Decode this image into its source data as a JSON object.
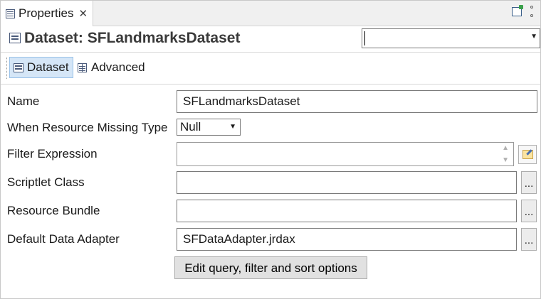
{
  "tab": {
    "label": "Properties",
    "close_glyph": "✕"
  },
  "header": {
    "title": "Dataset: SFLandmarksDataset",
    "dropdown_value": ""
  },
  "subtabs": [
    {
      "label": "Dataset",
      "icon": "dataset-icon",
      "active": true
    },
    {
      "label": "Advanced",
      "icon": "grid-icon",
      "active": false
    }
  ],
  "form": {
    "name": {
      "label": "Name",
      "value": "SFLandmarksDataset"
    },
    "resource_missing": {
      "label": "When Resource Missing Type",
      "value": "Null"
    },
    "filter_expression": {
      "label": "Filter Expression",
      "value": ""
    },
    "scriptlet_class": {
      "label": "Scriptlet Class",
      "value": "",
      "button": "..."
    },
    "resource_bundle": {
      "label": "Resource Bundle",
      "value": "",
      "button": "..."
    },
    "default_adapter": {
      "label": "Default Data Adapter",
      "value": "SFDataAdapter.jrdax",
      "button": "..."
    },
    "edit_button": "Edit query, filter and sort options"
  },
  "colors": {
    "active_subtab": "#d5e6f7",
    "button_bg": "#e1e1e1"
  }
}
